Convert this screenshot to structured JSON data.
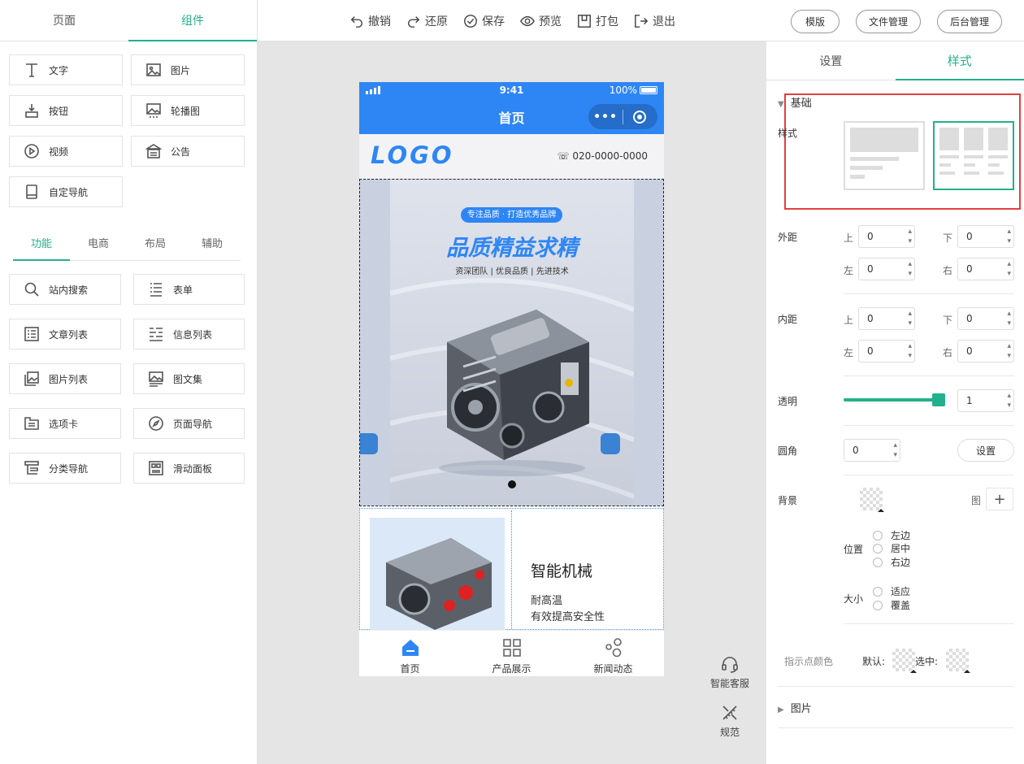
{
  "left_panel": {
    "tabs": [
      {
        "label": "页面"
      },
      {
        "label": "组件"
      }
    ],
    "basic_components": [
      {
        "label": "文字",
        "icon": "text-icon"
      },
      {
        "label": "图片",
        "icon": "image-icon"
      },
      {
        "label": "按钮",
        "icon": "button-icon"
      },
      {
        "label": "轮播图",
        "icon": "carousel-icon"
      },
      {
        "label": "视频",
        "icon": "video-icon"
      },
      {
        "label": "公告",
        "icon": "notice-icon"
      },
      {
        "label": "自定导航",
        "icon": "custom-nav-icon"
      }
    ],
    "func_tabs": [
      {
        "label": "功能"
      },
      {
        "label": "电商"
      },
      {
        "label": "布局"
      },
      {
        "label": "辅助"
      }
    ],
    "func_components": [
      {
        "label": "站内搜索",
        "icon": "search-icon"
      },
      {
        "label": "表单",
        "icon": "form-icon"
      },
      {
        "label": "文章列表",
        "icon": "article-list-icon"
      },
      {
        "label": "信息列表",
        "icon": "info-list-icon"
      },
      {
        "label": "图片列表",
        "icon": "image-list-icon"
      },
      {
        "label": "图文集",
        "icon": "image-text-icon"
      },
      {
        "label": "选项卡",
        "icon": "tabs-icon"
      },
      {
        "label": "页面导航",
        "icon": "page-nav-icon"
      },
      {
        "label": "分类导航",
        "icon": "category-nav-icon"
      },
      {
        "label": "滑动面板",
        "icon": "slide-panel-icon"
      }
    ]
  },
  "toolbar": {
    "actions": [
      {
        "label": "撤销",
        "icon": "undo-icon"
      },
      {
        "label": "还原",
        "icon": "redo-icon"
      },
      {
        "label": "保存",
        "icon": "check-circle-icon"
      },
      {
        "label": "预览",
        "icon": "eye-icon"
      },
      {
        "label": "打包",
        "icon": "package-icon"
      },
      {
        "label": "退出",
        "icon": "exit-icon"
      }
    ],
    "right_buttons": [
      {
        "label": "模版"
      },
      {
        "label": "文件管理"
      },
      {
        "label": "后台管理"
      }
    ]
  },
  "phone": {
    "status": {
      "time": "9:41",
      "battery": "100%"
    },
    "nav_title": "首页",
    "capsule_dots": "•••",
    "logo": "LOGO",
    "phone_number": "020-0000-0000",
    "banner": {
      "tag": "专注品质 · 打造优秀品牌",
      "headline": "品质精益求精",
      "subline": "资深团队  |  优良品质  |  先进技术"
    },
    "product": {
      "name": "智能机械",
      "desc1": "耐高温",
      "desc2": "有效提高安全性"
    },
    "tabbar": [
      {
        "label": "首页",
        "icon": "home-icon"
      },
      {
        "label": "产品展示",
        "icon": "grid-icon"
      },
      {
        "label": "新闻动态",
        "icon": "bubbles-icon"
      }
    ]
  },
  "floating": [
    {
      "label": "智能客服",
      "icon": "headset-icon"
    },
    {
      "label": "规范",
      "icon": "ruler-pencil-icon"
    }
  ],
  "right_panel": {
    "tabs": [
      {
        "label": "设置"
      },
      {
        "label": "样式"
      }
    ],
    "section_basic": "基础",
    "style_label": "样式",
    "margin": {
      "label": "外距",
      "top_label": "上",
      "bottom_label": "下",
      "left_label": "左",
      "right_label": "右",
      "top": "0",
      "bottom": "0",
      "left": "0",
      "right": "0"
    },
    "padding": {
      "label": "内距",
      "top_label": "上",
      "bottom_label": "下",
      "left_label": "左",
      "right_label": "右",
      "top": "0",
      "bottom": "0",
      "left": "0",
      "right": "0"
    },
    "opacity": {
      "label": "透明",
      "value": "1",
      "fraction": 1
    },
    "radius": {
      "label": "圆角",
      "value": "0",
      "button": "设置"
    },
    "background": {
      "label": "背景",
      "image_label": "图",
      "add": "+",
      "position_label": "位置",
      "positions": [
        "左边",
        "居中",
        "右边"
      ],
      "size_label": "大小",
      "sizes": [
        "适应",
        "覆盖"
      ]
    },
    "indicator": {
      "label": "指示点颜色",
      "default_label": "默认:",
      "selected_label": "选中:"
    },
    "section_image": "图片",
    "accent_color": "#23b08c",
    "highlight_color": "#e04040"
  }
}
